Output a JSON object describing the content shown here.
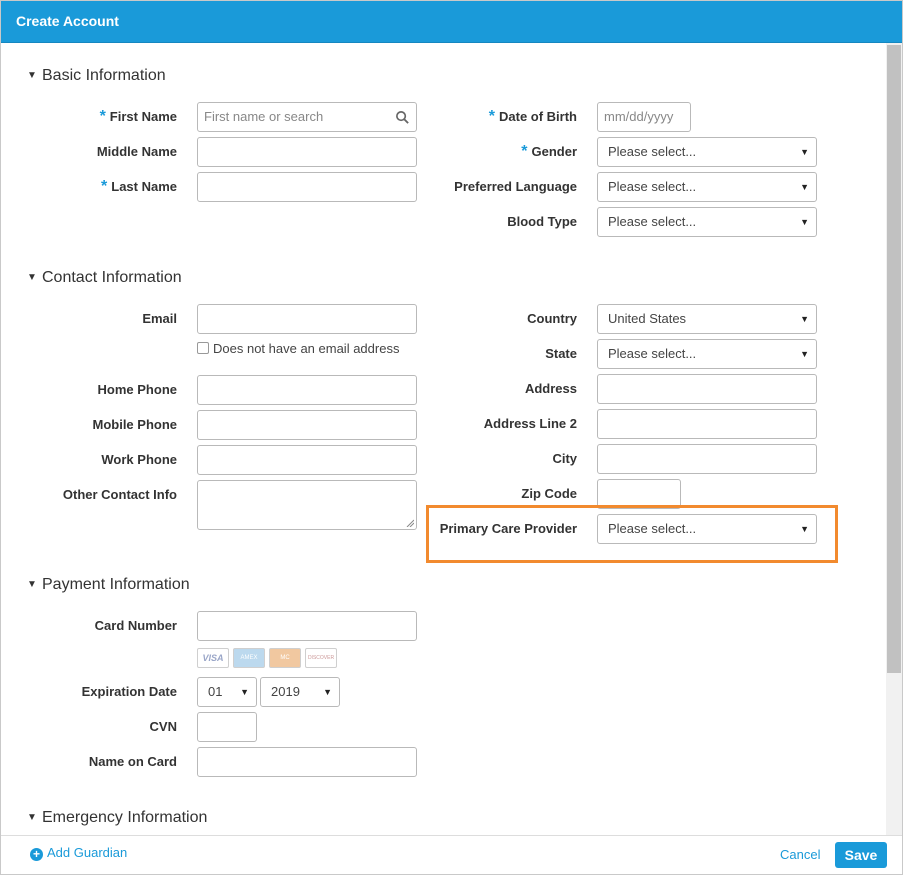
{
  "dialog": {
    "title": "Create Account"
  },
  "sections": {
    "basic": "Basic Information",
    "contact": "Contact Information",
    "payment": "Payment Information",
    "emergency": "Emergency Information"
  },
  "basic": {
    "first_name_label": "First Name",
    "first_name_placeholder": "First name or search",
    "middle_name_label": "Middle Name",
    "last_name_label": "Last Name",
    "dob_label": "Date of Birth",
    "dob_placeholder": "mm/dd/yyyy",
    "gender_label": "Gender",
    "gender_value": "Please select...",
    "language_label": "Preferred Language",
    "language_value": "Please select...",
    "blood_label": "Blood Type",
    "blood_value": "Please select..."
  },
  "contact": {
    "email_label": "Email",
    "no_email_label": "Does not have an email address",
    "home_phone_label": "Home Phone",
    "mobile_phone_label": "Mobile Phone",
    "work_phone_label": "Work Phone",
    "other_label": "Other Contact Info",
    "country_label": "Country",
    "country_value": "United States",
    "state_label": "State",
    "state_value": "Please select...",
    "address_label": "Address",
    "address2_label": "Address Line 2",
    "city_label": "City",
    "zip_label": "Zip Code",
    "pcp_label": "Primary Care Provider",
    "pcp_value": "Please select..."
  },
  "payment": {
    "card_number_label": "Card Number",
    "card_logos": [
      "VISA",
      "AMEX",
      "MC",
      "DISCOVER"
    ],
    "expiration_label": "Expiration Date",
    "exp_month": "01",
    "exp_year": "2019",
    "cvn_label": "CVN",
    "name_on_card_label": "Name on Card"
  },
  "footer": {
    "add_guardian": "Add Guardian",
    "cancel": "Cancel",
    "save": "Save"
  },
  "colors": {
    "accent": "#1a9ad9",
    "highlight": "#f28a2e"
  },
  "icons": {
    "search": "search-icon",
    "dropdown": "dropdown-arrow-icon",
    "add": "plus-circle-icon",
    "collapse": "collapse-triangle-icon"
  }
}
